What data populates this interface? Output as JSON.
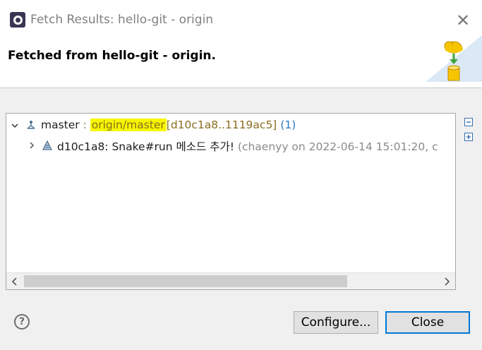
{
  "window": {
    "title": "Fetch Results: hello-git - origin",
    "app_icon": "eclipse-icon",
    "close_glyph": "✕"
  },
  "banner": {
    "heading": "Fetched from hello-git - origin.",
    "graphic": "fetch-cloud-database-icon"
  },
  "tree": {
    "ref_row": {
      "expanded": true,
      "icon": "branch-icon",
      "branch": "master",
      "separator": " : ",
      "remote_ref": "origin/master",
      "range": "[d10c1a8..1119ac5]",
      "count": "(1)"
    },
    "commit_row": {
      "expanded": false,
      "icon": "commit-icon",
      "text": "d10c1a8: Snake#run 메소드 추가!",
      "meta": "(chaenyy on 2022-06-14 15:01:20, c"
    }
  },
  "side_buttons": {
    "collapse": "collapse-all-icon",
    "expand": "expand-all-icon"
  },
  "footer": {
    "help": "?",
    "configure_label": "Configure...",
    "close_label": "Close"
  },
  "colors": {
    "highlight": "#f6f600",
    "ref_text": "#8a6e1e",
    "count_text": "#2a79c2",
    "default_button_border": "#0078d7"
  }
}
